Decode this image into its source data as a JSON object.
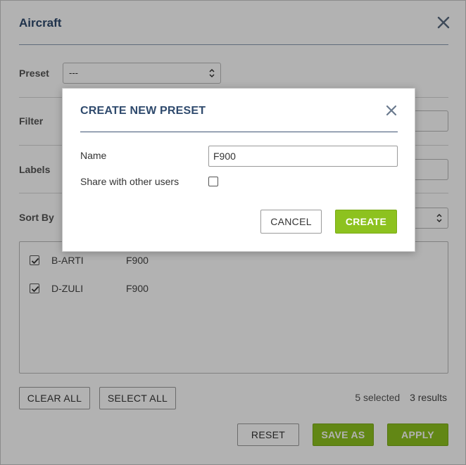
{
  "panel": {
    "title": "Aircraft",
    "preset_label": "Preset",
    "preset_value": "---",
    "filter_label": "Filter",
    "labels_label": "Labels",
    "sortby_label": "Sort By",
    "sortby_value": ""
  },
  "list": {
    "items": [
      {
        "registration": "B-ARTI",
        "type": "F900",
        "checked": true
      },
      {
        "registration": "D-ZULI",
        "type": "F900",
        "checked": true
      }
    ]
  },
  "footer": {
    "clear_all_label": "CLEAR ALL",
    "select_all_label": "SELECT ALL",
    "selected_count": "5 selected",
    "results_count": "3 results",
    "reset_label": "RESET",
    "save_as_label": "SAVE AS",
    "apply_label": "APPLY"
  },
  "modal": {
    "title": "CREATE NEW PRESET",
    "name_label": "Name",
    "name_value": "F900",
    "share_label": "Share with other users",
    "share_checked": false,
    "cancel_label": "CANCEL",
    "create_label": "CREATE"
  },
  "colors": {
    "title": "#2f4a6d",
    "accent_green": "#8dc21f"
  },
  "icons": {
    "close": "close-icon",
    "select_arrow": "sort-arrows-icon",
    "checkbox": "checkmark-icon"
  }
}
